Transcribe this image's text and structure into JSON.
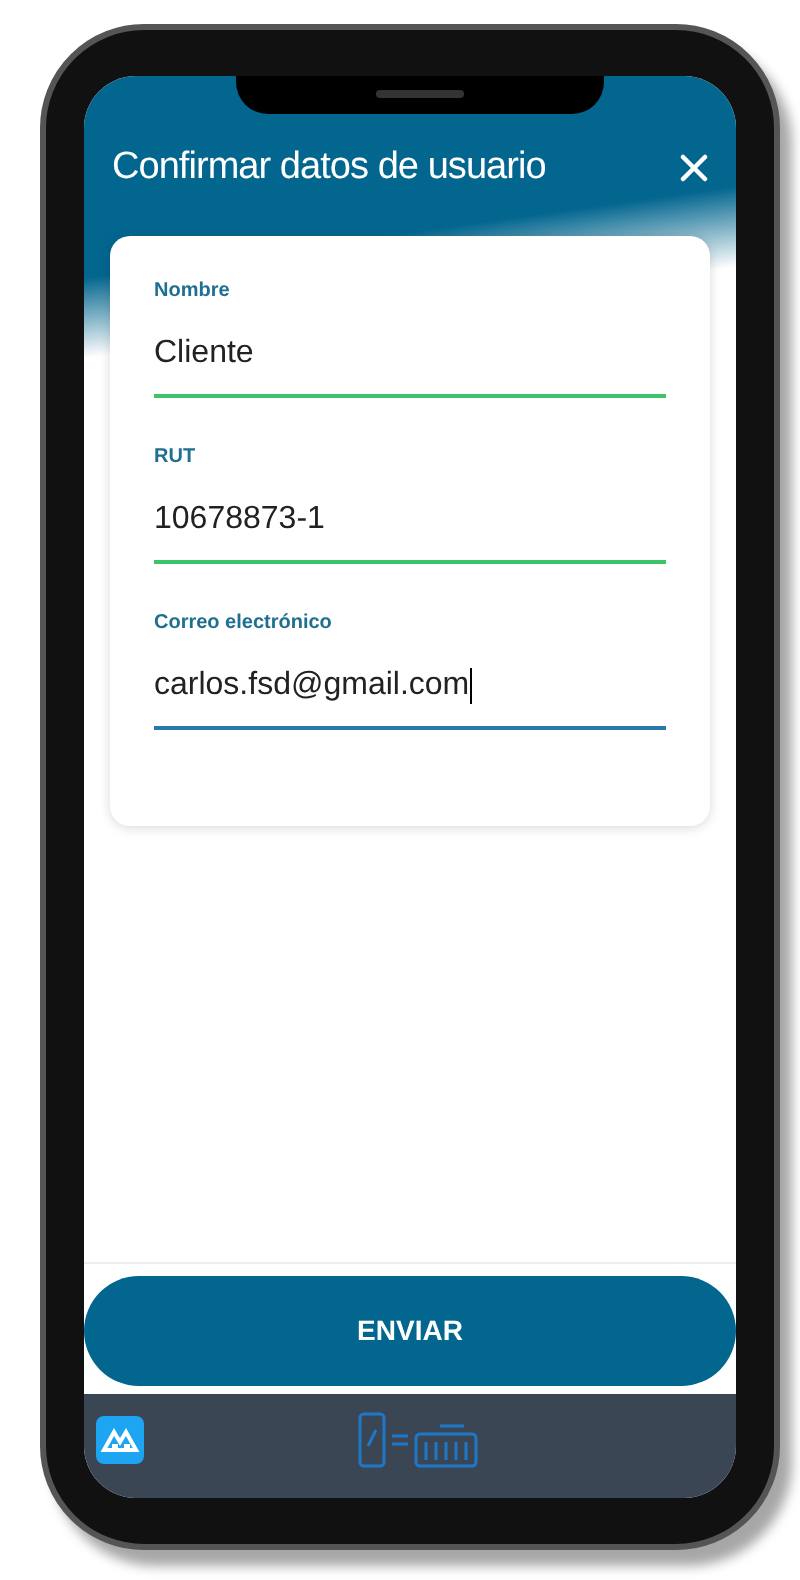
{
  "header": {
    "title": "Confirmar datos de usuario"
  },
  "fields": [
    {
      "label": "Nombre",
      "value": "Cliente",
      "focused": false
    },
    {
      "label": "RUT",
      "value": "10678873-1",
      "focused": false
    },
    {
      "label": "Correo electrónico",
      "value": "carlos.fsd@gmail.com",
      "focused": true
    }
  ],
  "submit_button": "ENVIAR"
}
